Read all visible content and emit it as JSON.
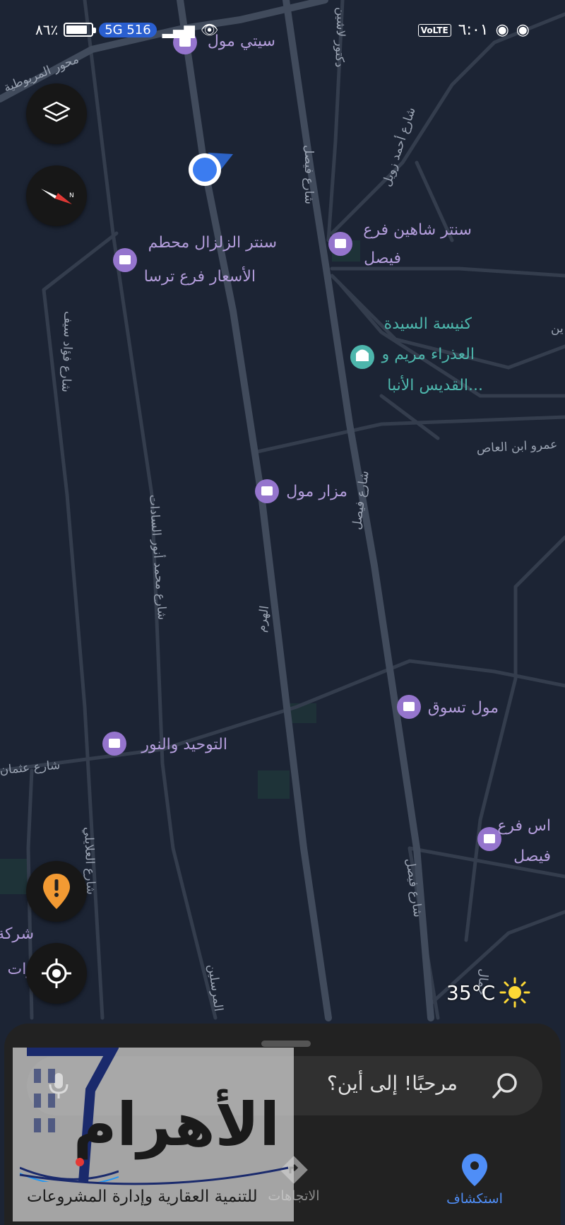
{
  "status_bar": {
    "battery_text": "٨٦٪",
    "battery_level": 0.86,
    "network": "5G 516",
    "time": "٦:٠١"
  },
  "map": {
    "pois": [
      {
        "label": "سيتي مول",
        "kind": "shopping"
      },
      {
        "label_line1": "سنتر الزلزال محطم",
        "label_line2": "الأسعار فرع ترسا",
        "kind": "shopping"
      },
      {
        "label_line1": "سنتر شاهين فرع",
        "label_line2": "فيصل",
        "kind": "shopping"
      },
      {
        "label_line1": "كنيسة السيدة",
        "label_line2": "العذراء مريم و",
        "label_line3": "القديس الأنبا...",
        "kind": "worship"
      },
      {
        "label": "مزار مول",
        "kind": "shopping"
      },
      {
        "label": "مول تسوق",
        "kind": "shopping"
      },
      {
        "label": "التوحيد والنور",
        "kind": "shopping"
      },
      {
        "label_line1": "اس فرع",
        "label_line2": "فيصل",
        "kind": "shopping"
      },
      {
        "label_line1": "شركة",
        "label_line2": "وات",
        "kind": "shopping"
      }
    ],
    "streets": [
      "محور المريوطية",
      "دكتور لاشين",
      "شارع أحمد زويل",
      "شارع فيصل",
      "شارع فيصل",
      "شارع فيصل",
      "شارع فؤاد سيف",
      "شارع محمد أنور السادات",
      "الهرم",
      "عمرو ابن العاص",
      "شارع عثمان",
      "شارع العلايلي",
      "المرسلين",
      "ين"
    ]
  },
  "controls": {
    "layers": "layers-icon",
    "compass": "compass-icon",
    "report": "report-icon",
    "locate": "my-location-icon"
  },
  "weather": {
    "temp": "35°C",
    "icon": "sun-icon"
  },
  "search": {
    "placeholder": "مرحبًا! إلى أين؟"
  },
  "bottom_nav": {
    "tabs": [
      {
        "label": "استكشاف",
        "active": true
      },
      {
        "label": "الاتجاهات",
        "active": false
      }
    ]
  },
  "watermark": {
    "title": "الأهرام",
    "subtitle": "للتنمية العقارية وإدارة المشروعات"
  },
  "colors": {
    "map_bg": "#1c2434",
    "road": "#3d4656",
    "poi_purple": "#9575cd",
    "accent_blue": "#4f8ef7",
    "report_orange": "#f29a33"
  }
}
